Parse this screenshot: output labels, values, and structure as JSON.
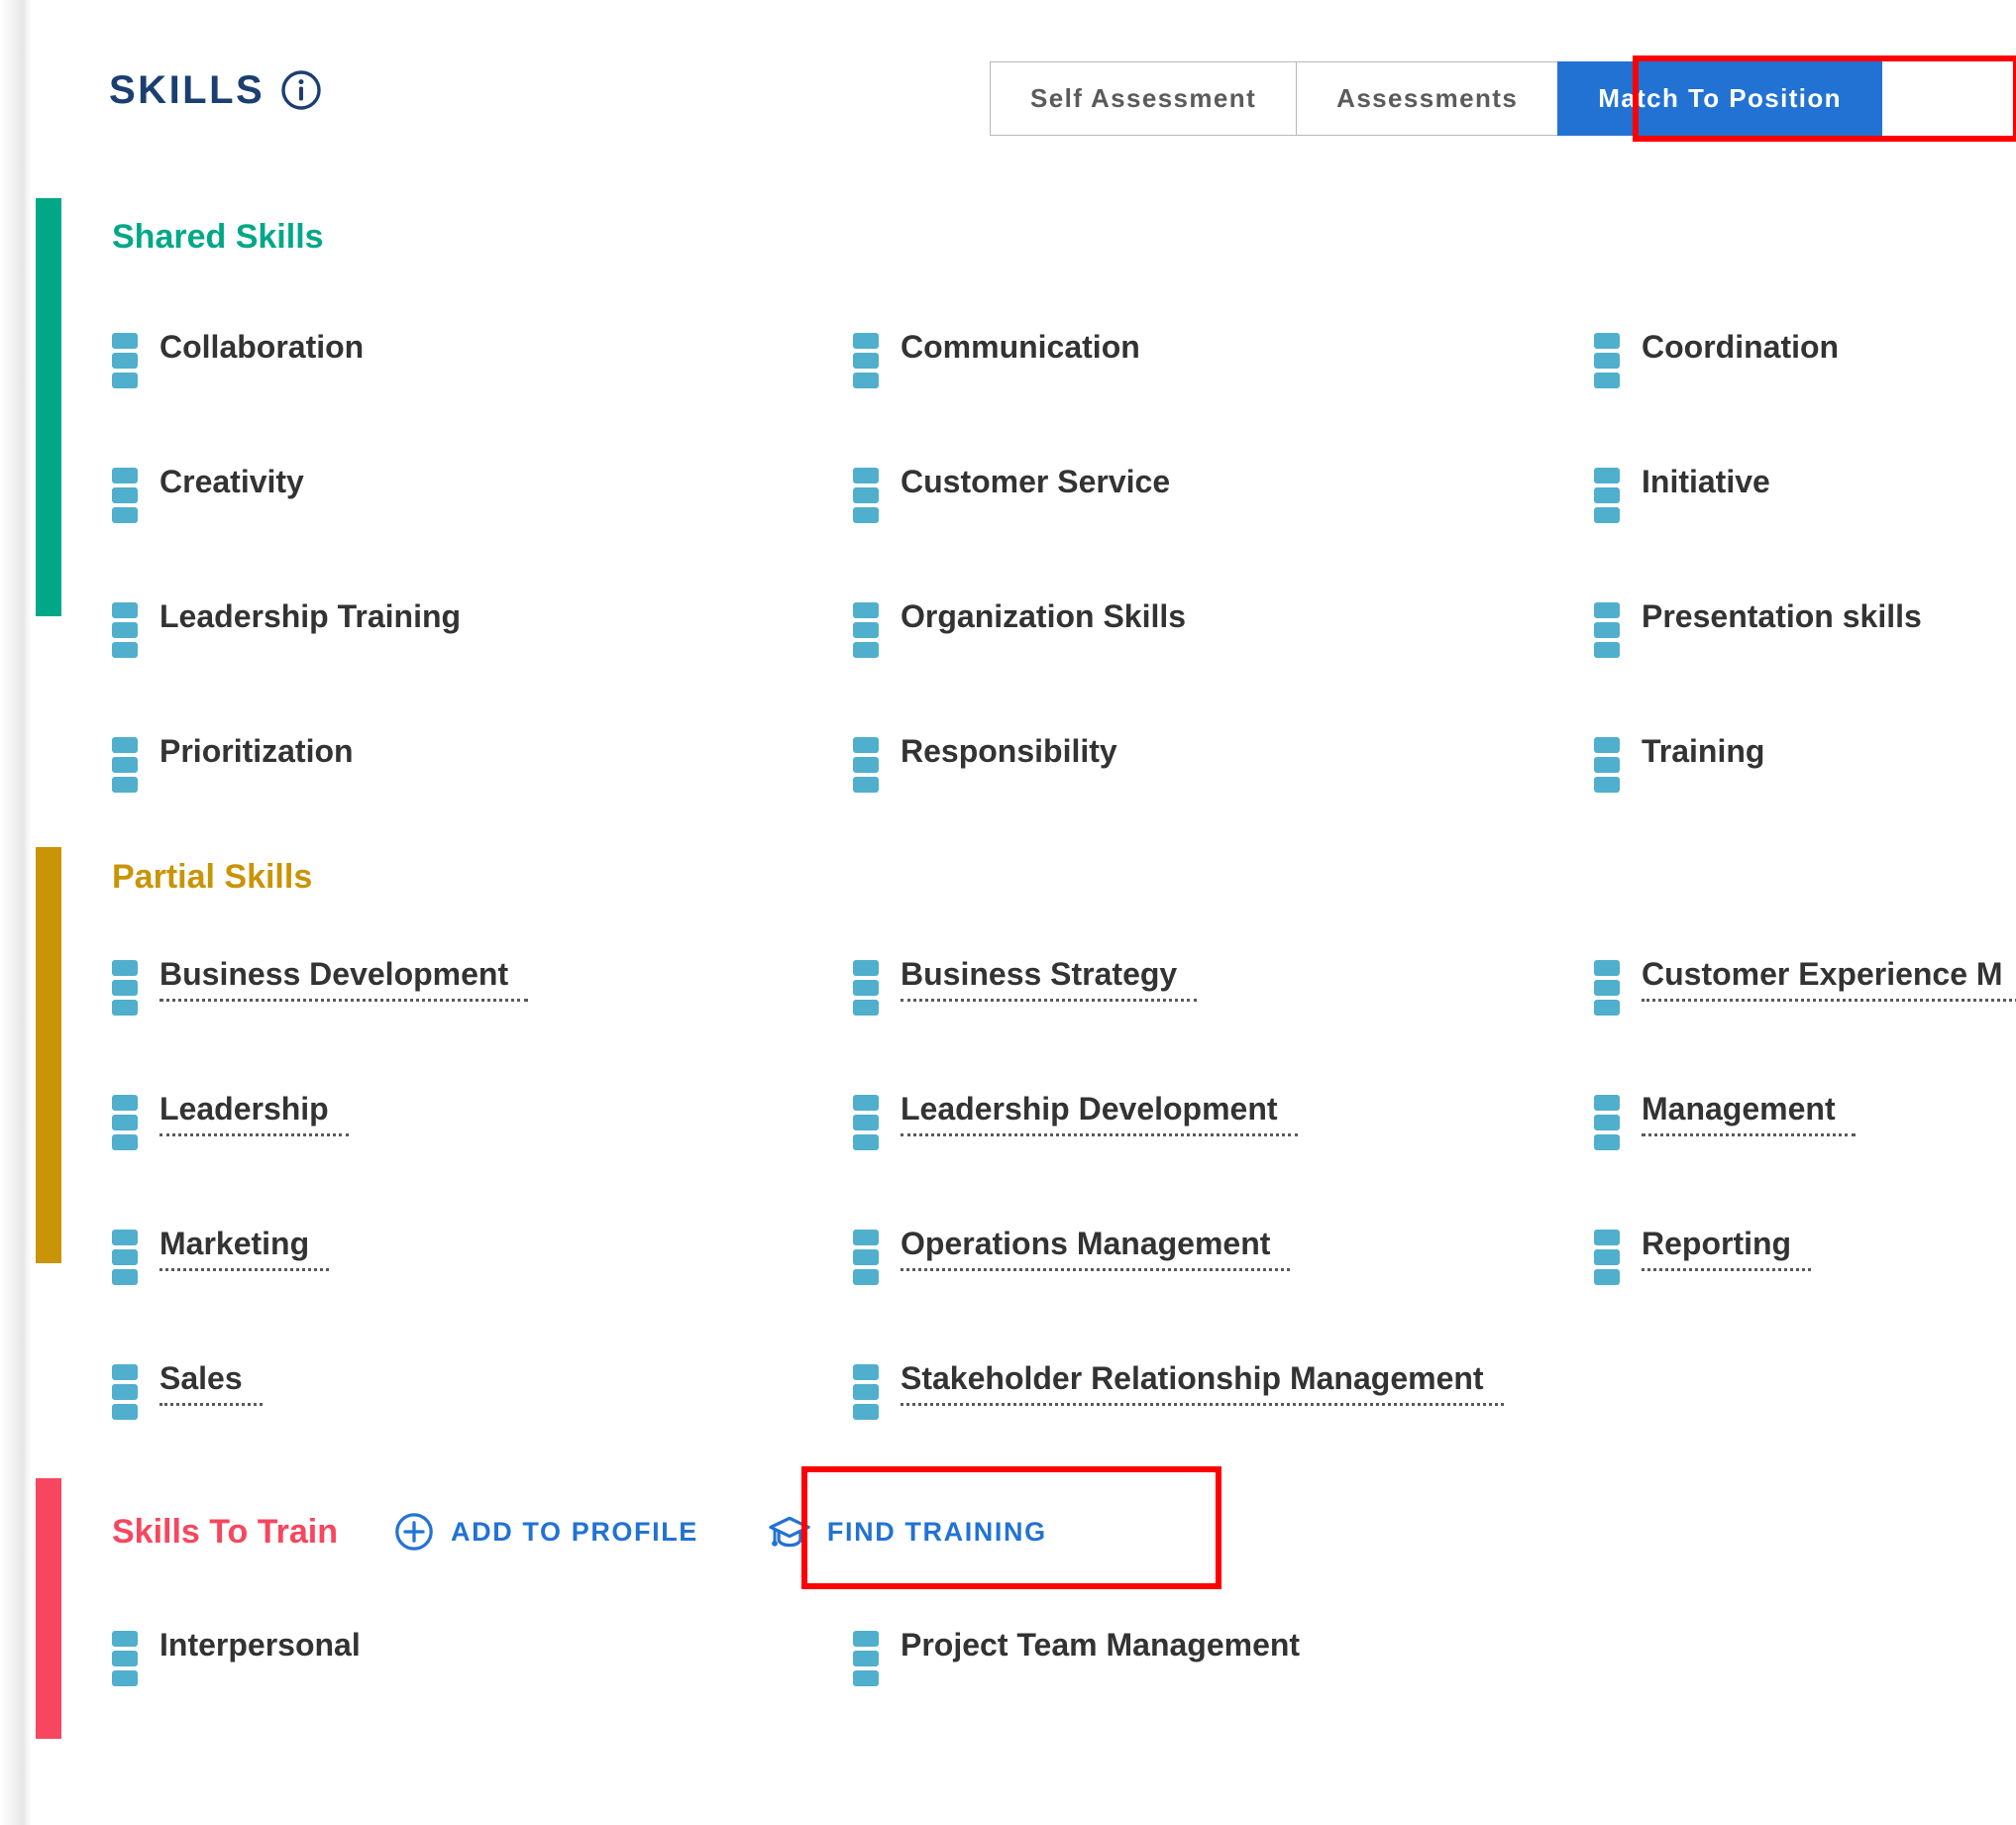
{
  "header": {
    "title": "SKILLS",
    "info_icon": "info-circle-icon",
    "accent_color": "#1b3f70"
  },
  "tabs": [
    {
      "label": "Self Assessment",
      "active": false
    },
    {
      "label": "Assessments",
      "active": false
    },
    {
      "label": "Match To Position",
      "active": true
    }
  ],
  "highlight_color": "#fe0000",
  "active_tab_color": "#2272d4",
  "sections": [
    {
      "id": "shared-skills",
      "title": "Shared Skills",
      "color": "#00a887",
      "dotted": false,
      "skills": [
        "Collaboration",
        "Communication",
        "Coordination",
        "Creativity",
        "Customer Service",
        "Initiative",
        "Leadership Training",
        "Organization Skills",
        "Presentation skills",
        "Prioritization",
        "Responsibility",
        "Training"
      ]
    },
    {
      "id": "partial-skills",
      "title": "Partial Skills",
      "color": "#c99405",
      "dotted": true,
      "skills": [
        "Business Development",
        "Business Strategy",
        "Customer Experience M",
        "Leadership",
        "Leadership Development",
        "Management",
        "Marketing",
        "Operations Management",
        "Reporting",
        "Sales",
        "Stakeholder Relationship Management",
        ""
      ]
    },
    {
      "id": "skills-to-train",
      "title": "Skills To Train",
      "color": "#f6475e",
      "dotted": false,
      "actions": [
        {
          "label": "ADD TO PROFILE",
          "icon": "plus-circle-icon",
          "highlighted": false
        },
        {
          "label": "FIND TRAINING",
          "icon": "graduation-cap-icon",
          "highlighted": true
        }
      ],
      "skills": [
        "Interpersonal",
        "Project Team Management",
        ""
      ]
    }
  ]
}
